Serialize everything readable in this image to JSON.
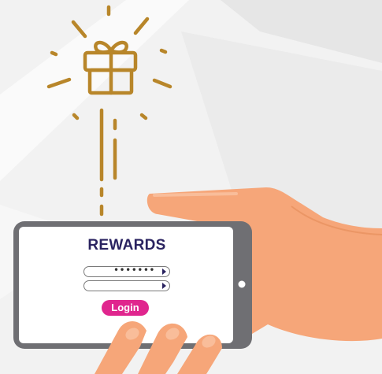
{
  "app": {
    "title": "REWARDS",
    "password_field": {
      "value": "•••••••"
    },
    "second_field": {
      "value": ""
    },
    "login_label": "Login"
  },
  "icons": {
    "gift": "gift-icon",
    "spark": "spark-line-icon"
  },
  "colors": {
    "accent_gold": "#b8862a",
    "brand_navy": "#2a2360",
    "button_pink": "#e0268e",
    "skin": "#f6a679",
    "phone_frame": "#6f6f73"
  }
}
